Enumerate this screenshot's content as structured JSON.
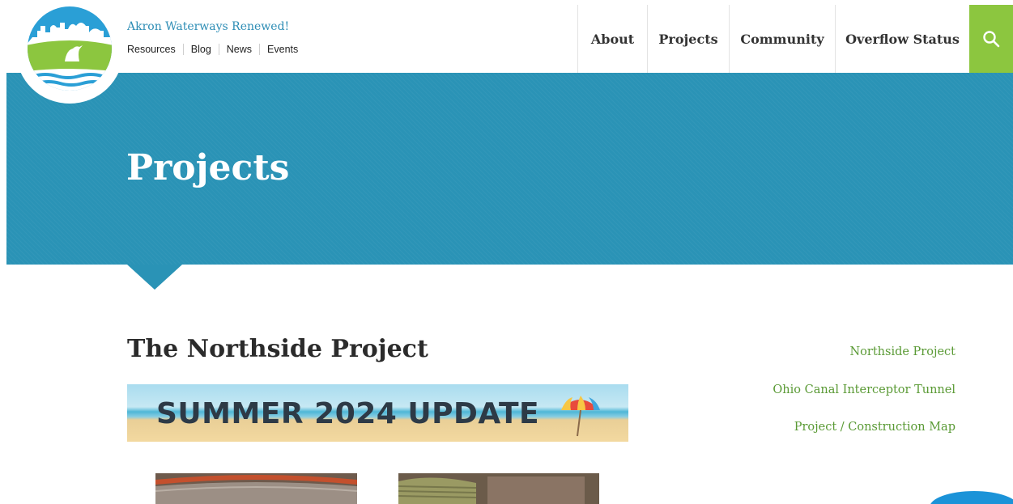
{
  "site": {
    "title": "Akron Waterways Renewed!"
  },
  "utility_nav": [
    "Resources",
    "Blog",
    "News",
    "Events"
  ],
  "main_nav": {
    "about": "About",
    "projects": "Projects",
    "community": "Community",
    "overflow": "Overflow Status"
  },
  "hero": {
    "title": "Projects"
  },
  "content": {
    "section_title": "The Northside Project",
    "banner_text": "SUMMER 2024 UPDATE"
  },
  "side_links": [
    "Northside Project",
    "Ohio Canal Interceptor Tunnel",
    "Project / Construction Map"
  ],
  "icons": {
    "search": "search-icon",
    "logo": "heron-logo-icon",
    "umbrella": "beach-umbrella-icon"
  },
  "colors": {
    "hero": "#2a93b6",
    "search": "#8cc63f",
    "link": "#5a9a35",
    "site_title": "#2d8db5"
  }
}
